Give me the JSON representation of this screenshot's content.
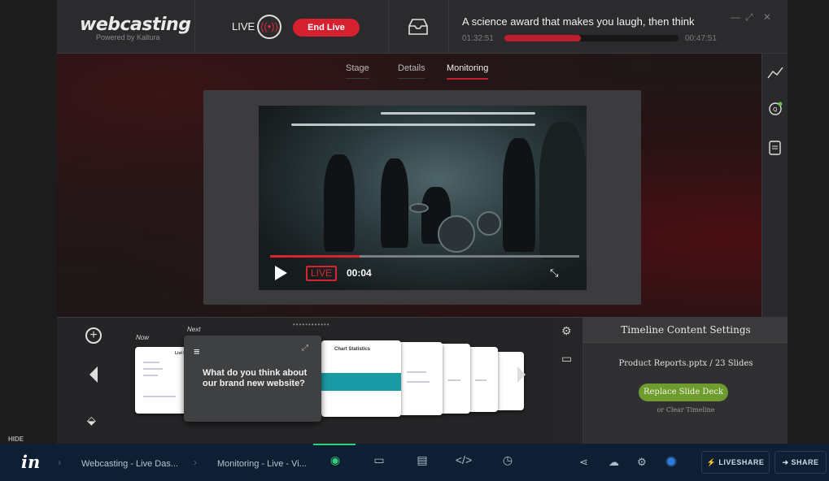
{
  "brand": {
    "name": "webcasting",
    "tagline": "Powered by Kaltura"
  },
  "live": {
    "label": "LIVE",
    "end_label": "End Live"
  },
  "session": {
    "title": "A science award that makes you laugh, then think",
    "elapsed": "01:32:51",
    "remaining": "00:47:51",
    "progress": 0.44
  },
  "tabs": [
    {
      "label": "Stage"
    },
    {
      "label": "Details"
    },
    {
      "label": "Monitoring",
      "active": true
    }
  ],
  "player": {
    "live_tag": "LIVE",
    "time": "00:04",
    "progress": 0.29
  },
  "slides": {
    "now_label": "Now",
    "next_label": "Next",
    "question": "What do you think about our brand new website?",
    "chart_title": "Chart Statistics",
    "list_title": "List I"
  },
  "timeline": {
    "title": "Timeline Content Settings",
    "file": "Product Reports.pptx / 23 Slides",
    "replace_label": "Replace Slide Deck",
    "clear_label": "or Clear Timeline"
  },
  "hide_label": "HIDE",
  "footer": {
    "crumbs": [
      "Webcasting - Live Das...",
      "Monitoring - Live - Vi..."
    ],
    "modes": [
      "eye-icon",
      "comment-cursor-icon",
      "note-icon",
      "code-icon",
      "history-icon"
    ],
    "liveshare_label": "LIVESHARE",
    "share_label": "SHARE"
  },
  "colors": {
    "accent_red": "#c21d2c",
    "accent_green": "#6e9b2e",
    "invision_green": "#2fd27a",
    "footer_bg": "#0e1f33"
  }
}
